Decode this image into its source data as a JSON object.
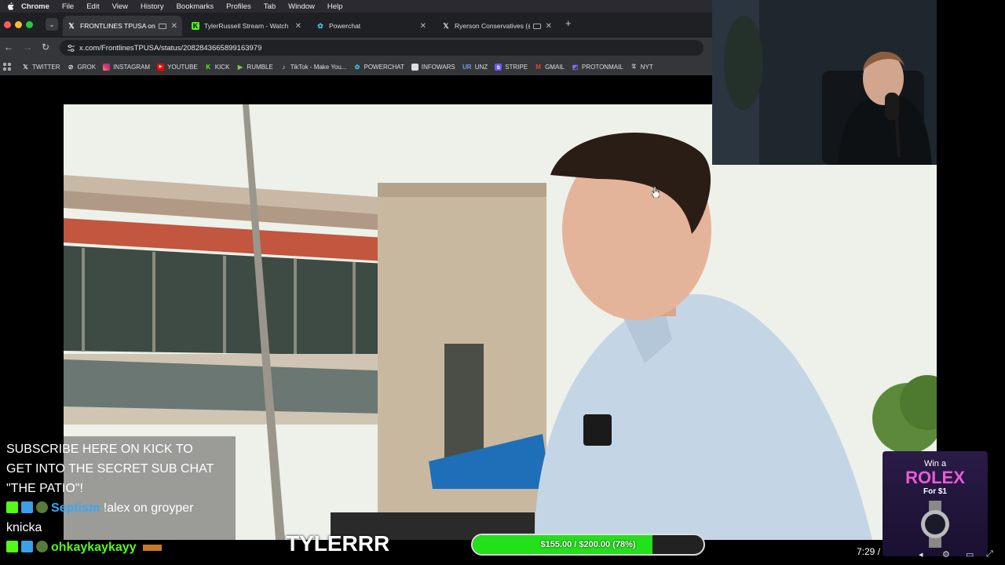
{
  "menubar": {
    "app": "Chrome",
    "items": [
      "File",
      "Edit",
      "View",
      "History",
      "Bookmarks",
      "Profiles",
      "Tab",
      "Window",
      "Help"
    ]
  },
  "tabs": [
    {
      "title": "FRONTLINES TPUSA on",
      "icon": "x-logo-icon",
      "active": true
    },
    {
      "title": "TylerRussell Stream - Watch",
      "icon": "kick-logo-icon",
      "active": false
    },
    {
      "title": "Powerchat",
      "icon": "powerchat-icon",
      "active": false
    },
    {
      "title": "Ryerson Conservatives (@",
      "icon": "x-logo-icon",
      "active": false
    }
  ],
  "address": {
    "url": "x.com/FrontlinesTPUSA/status/2082843665899163979"
  },
  "bookmarks": [
    {
      "label": "TWITTER",
      "icon": "x-logo-icon",
      "color": "#ffffff"
    },
    {
      "label": "GROK",
      "icon": "grok-icon",
      "color": "#ffffff"
    },
    {
      "label": "INSTAGRAM",
      "icon": "instagram-icon",
      "color": "#e1306c"
    },
    {
      "label": "YOUTUBE",
      "icon": "youtube-icon",
      "color": "#ff0000"
    },
    {
      "label": "KICK",
      "icon": "kick-logo-icon",
      "color": "#53fc18"
    },
    {
      "label": "RUMBLE",
      "icon": "rumble-icon",
      "color": "#85c742"
    },
    {
      "label": "TikTok - Make You...",
      "icon": "tiktok-icon",
      "color": "#ffffff"
    },
    {
      "label": "POWERCHAT",
      "icon": "powerchat-icon",
      "color": "#3ec7d8"
    },
    {
      "label": "INFOWARS",
      "icon": "infowars-icon",
      "color": "#dddddd"
    },
    {
      "label": "UNZ",
      "icon": "unz-icon",
      "color": "#6f9cf0"
    },
    {
      "label": "STRIPE",
      "icon": "stripe-icon",
      "color": "#635bff"
    },
    {
      "label": "GMAIL",
      "icon": "gmail-icon",
      "color": "#ea4335"
    },
    {
      "label": "PROTONMAIL",
      "icon": "protonmail-icon",
      "color": "#8b6cf6"
    },
    {
      "label": "NYT",
      "icon": "nyt-icon",
      "color": "#ffffff"
    }
  ],
  "chat": {
    "announcement": [
      "SUBSCRIBE HERE ON KICK TO",
      "GET INTO THE SECRET SUB CHAT",
      "\"THE PATIO\"!"
    ],
    "messages": [
      {
        "user": "Septism",
        "text": "!alex on groyper",
        "text_cont": "knicka"
      },
      {
        "user": "ohkaykaykayy",
        "text": ""
      }
    ]
  },
  "overlay": {
    "streamer_name": "TYLERRR",
    "goal_text": "$155.00 / $200.00 (78%)",
    "goal_progress": 0.78,
    "colors": {
      "goal_fill": "#22e01a",
      "kick_green": "#53fc18"
    }
  },
  "ad": {
    "line1": "Win a",
    "brand": "ROLEX",
    "line2": "For $1"
  },
  "player": {
    "time": "7:29 / "
  }
}
